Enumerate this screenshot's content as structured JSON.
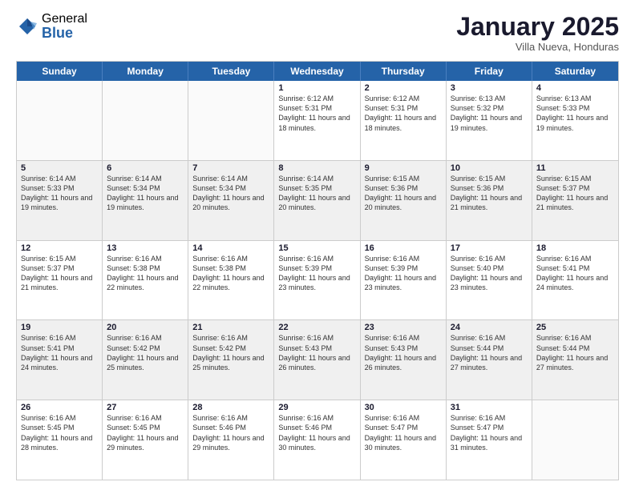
{
  "logo": {
    "general": "General",
    "blue": "Blue"
  },
  "title": "January 2025",
  "subtitle": "Villa Nueva, Honduras",
  "days": [
    "Sunday",
    "Monday",
    "Tuesday",
    "Wednesday",
    "Thursday",
    "Friday",
    "Saturday"
  ],
  "weeks": [
    [
      {
        "day": "",
        "text": ""
      },
      {
        "day": "",
        "text": ""
      },
      {
        "day": "",
        "text": ""
      },
      {
        "day": "1",
        "text": "Sunrise: 6:12 AM\nSunset: 5:31 PM\nDaylight: 11 hours and 18 minutes."
      },
      {
        "day": "2",
        "text": "Sunrise: 6:12 AM\nSunset: 5:31 PM\nDaylight: 11 hours and 18 minutes."
      },
      {
        "day": "3",
        "text": "Sunrise: 6:13 AM\nSunset: 5:32 PM\nDaylight: 11 hours and 19 minutes."
      },
      {
        "day": "4",
        "text": "Sunrise: 6:13 AM\nSunset: 5:33 PM\nDaylight: 11 hours and 19 minutes."
      }
    ],
    [
      {
        "day": "5",
        "text": "Sunrise: 6:14 AM\nSunset: 5:33 PM\nDaylight: 11 hours and 19 minutes."
      },
      {
        "day": "6",
        "text": "Sunrise: 6:14 AM\nSunset: 5:34 PM\nDaylight: 11 hours and 19 minutes."
      },
      {
        "day": "7",
        "text": "Sunrise: 6:14 AM\nSunset: 5:34 PM\nDaylight: 11 hours and 20 minutes."
      },
      {
        "day": "8",
        "text": "Sunrise: 6:14 AM\nSunset: 5:35 PM\nDaylight: 11 hours and 20 minutes."
      },
      {
        "day": "9",
        "text": "Sunrise: 6:15 AM\nSunset: 5:36 PM\nDaylight: 11 hours and 20 minutes."
      },
      {
        "day": "10",
        "text": "Sunrise: 6:15 AM\nSunset: 5:36 PM\nDaylight: 11 hours and 21 minutes."
      },
      {
        "day": "11",
        "text": "Sunrise: 6:15 AM\nSunset: 5:37 PM\nDaylight: 11 hours and 21 minutes."
      }
    ],
    [
      {
        "day": "12",
        "text": "Sunrise: 6:15 AM\nSunset: 5:37 PM\nDaylight: 11 hours and 21 minutes."
      },
      {
        "day": "13",
        "text": "Sunrise: 6:16 AM\nSunset: 5:38 PM\nDaylight: 11 hours and 22 minutes."
      },
      {
        "day": "14",
        "text": "Sunrise: 6:16 AM\nSunset: 5:38 PM\nDaylight: 11 hours and 22 minutes."
      },
      {
        "day": "15",
        "text": "Sunrise: 6:16 AM\nSunset: 5:39 PM\nDaylight: 11 hours and 23 minutes."
      },
      {
        "day": "16",
        "text": "Sunrise: 6:16 AM\nSunset: 5:39 PM\nDaylight: 11 hours and 23 minutes."
      },
      {
        "day": "17",
        "text": "Sunrise: 6:16 AM\nSunset: 5:40 PM\nDaylight: 11 hours and 23 minutes."
      },
      {
        "day": "18",
        "text": "Sunrise: 6:16 AM\nSunset: 5:41 PM\nDaylight: 11 hours and 24 minutes."
      }
    ],
    [
      {
        "day": "19",
        "text": "Sunrise: 6:16 AM\nSunset: 5:41 PM\nDaylight: 11 hours and 24 minutes."
      },
      {
        "day": "20",
        "text": "Sunrise: 6:16 AM\nSunset: 5:42 PM\nDaylight: 11 hours and 25 minutes."
      },
      {
        "day": "21",
        "text": "Sunrise: 6:16 AM\nSunset: 5:42 PM\nDaylight: 11 hours and 25 minutes."
      },
      {
        "day": "22",
        "text": "Sunrise: 6:16 AM\nSunset: 5:43 PM\nDaylight: 11 hours and 26 minutes."
      },
      {
        "day": "23",
        "text": "Sunrise: 6:16 AM\nSunset: 5:43 PM\nDaylight: 11 hours and 26 minutes."
      },
      {
        "day": "24",
        "text": "Sunrise: 6:16 AM\nSunset: 5:44 PM\nDaylight: 11 hours and 27 minutes."
      },
      {
        "day": "25",
        "text": "Sunrise: 6:16 AM\nSunset: 5:44 PM\nDaylight: 11 hours and 27 minutes."
      }
    ],
    [
      {
        "day": "26",
        "text": "Sunrise: 6:16 AM\nSunset: 5:45 PM\nDaylight: 11 hours and 28 minutes."
      },
      {
        "day": "27",
        "text": "Sunrise: 6:16 AM\nSunset: 5:45 PM\nDaylight: 11 hours and 29 minutes."
      },
      {
        "day": "28",
        "text": "Sunrise: 6:16 AM\nSunset: 5:46 PM\nDaylight: 11 hours and 29 minutes."
      },
      {
        "day": "29",
        "text": "Sunrise: 6:16 AM\nSunset: 5:46 PM\nDaylight: 11 hours and 30 minutes."
      },
      {
        "day": "30",
        "text": "Sunrise: 6:16 AM\nSunset: 5:47 PM\nDaylight: 11 hours and 30 minutes."
      },
      {
        "day": "31",
        "text": "Sunrise: 6:16 AM\nSunset: 5:47 PM\nDaylight: 11 hours and 31 minutes."
      },
      {
        "day": "",
        "text": ""
      }
    ]
  ]
}
